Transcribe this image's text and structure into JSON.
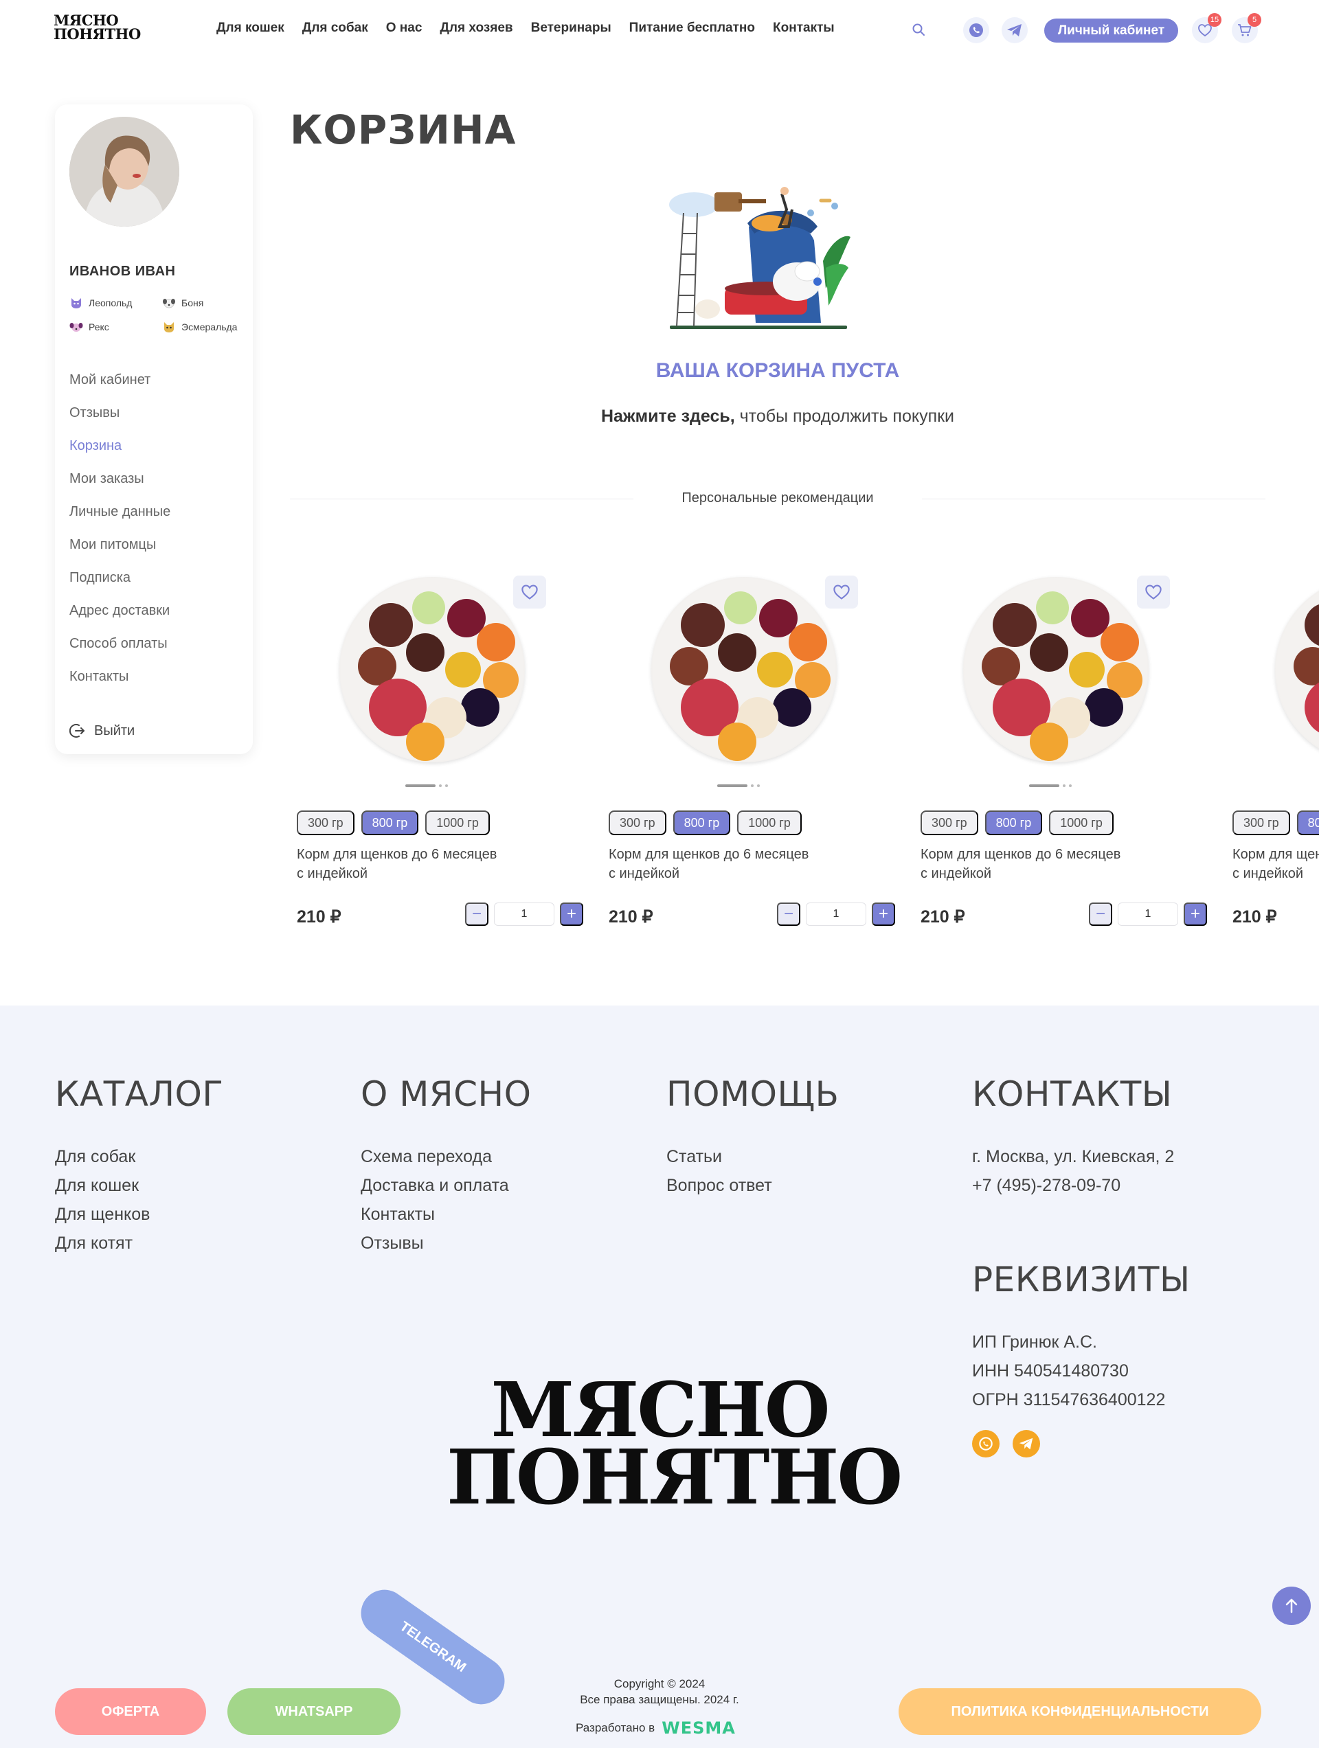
{
  "header": {
    "logo_line1": "МЯСНО",
    "logo_line2": "ПОНЯТНО",
    "nav": [
      "Для кошек",
      "Для собак",
      "О нас",
      "Для хозяев",
      "Ветеринары",
      "Питание бесплатно",
      "Контакты"
    ],
    "cabinet_label": "Личный кабинет",
    "favorites_count": "15",
    "cart_count": "5"
  },
  "sidebar": {
    "user_name": "ИВАНОВ ИВАН",
    "pets": [
      "Леопольд",
      "Боня",
      "Рекс",
      "Эсмеральда"
    ],
    "menu": [
      "Мой кабинет",
      "Отзывы",
      "Корзина",
      "Мои заказы",
      "Личные данные",
      "Мои питомцы",
      "Подписка",
      "Адрес доставки",
      "Способ оплаты",
      "Контакты"
    ],
    "active_item": "Корзина",
    "logout": "Выйти"
  },
  "main": {
    "title": "КОРЗИНА",
    "empty_title": "ВАША КОРЗИНА ПУСТА",
    "empty_sub_bold": "Нажмите здесь,",
    "empty_sub_rest": " чтобы продолжить покупки",
    "rec_title": "Персональные рекомендации",
    "product": {
      "weights": [
        "300 гр",
        "800 гр",
        "1000 гр"
      ],
      "active_weight": "800 гр",
      "name_line1": "Корм для щенков до 6 месяцев",
      "name_line2": "с индейкой",
      "price": "210 ₽",
      "qty": "1"
    }
  },
  "footer": {
    "catalog": {
      "title": "КАТАЛОГ",
      "links": [
        "Для собак",
        "Для кошек",
        "Для щенков",
        "Для котят"
      ]
    },
    "about": {
      "title": "О МЯСНО",
      "links": [
        "Схема перехода",
        "Доставка и оплата",
        "Контакты",
        "Отзывы"
      ]
    },
    "help": {
      "title": "ПОМОЩЬ",
      "links": [
        "Статьи",
        "Вопрос ответ"
      ]
    },
    "contacts": {
      "title": "КОНТАКТЫ",
      "address": "г. Москва, ул. Киевская, 2",
      "phone": "+7 (495)-278-09-70"
    },
    "requisites": {
      "title": "РЕКВИЗИТЫ",
      "lines": [
        "ИП Гринюк А.С.",
        "ИНН 540541480730",
        "ОГРН 311547636400122"
      ]
    },
    "logo_line1": "МЯСНО",
    "logo_line2": "ПОНЯТНО",
    "buttons": {
      "offer": "ОФЕРТА",
      "whatsapp": "WHATSAPP",
      "telegram": "TELEGRAM",
      "privacy": "ПОЛИТИКА КОНФИДЕНЦИАЛЬНОСТИ"
    },
    "copyright1": "Copyright © 2024",
    "copyright2": "Все права защищены. 2024 г.",
    "developed_by": "Разработано в",
    "developer": "WESMA"
  },
  "colors": {
    "accent": "#7a80d5",
    "badge": "#f15d5d",
    "offer": "#ff9c9c",
    "whatsapp": "#a3d68a",
    "telegram": "#8fa8e8",
    "privacy": "#ffc97a",
    "social": "#f5a623"
  }
}
